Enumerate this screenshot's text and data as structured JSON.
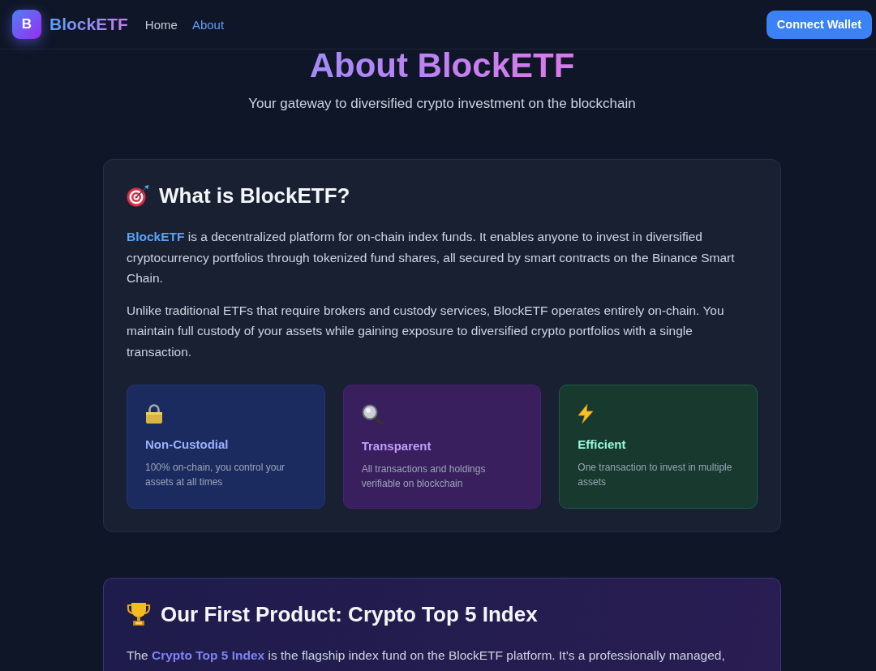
{
  "header": {
    "logo_letter": "B",
    "brand": "BlockETF",
    "nav": [
      {
        "label": "Home",
        "selected": false
      },
      {
        "label": "About",
        "selected": true
      }
    ],
    "button": "Connect Wallet"
  },
  "hero": {
    "title": "About BlockETF",
    "subtitle": "Your gateway to diversified crypto investment on the blockchain"
  },
  "sections": [
    {
      "kind": "standard",
      "heading": "What is BlockETF?",
      "paragraphs": [
        "**BlockETF** is a decentralized platform for on-chain index funds. It enables anyone to invest in diversified cryptocurrency portfolios through tokenized fund shares, all secured by smart contracts on the Binance Smart Chain.",
        "Unlike traditional ETFs that require brokers and custody services, BlockETF operates entirely on-chain. You maintain full custody of your assets while gaining exposure to diversified crypto portfolios with a single transaction."
      ],
      "features": [
        {
          "title": "Non-Custodial",
          "description": "100% on-chain, you control your assets at all times",
          "color": "#1c2b5f"
        },
        {
          "title": "Transparent",
          "description": "All transactions and holdings verifiable on blockchain",
          "color": "#391f5e"
        },
        {
          "title": "Efficient",
          "description": "One transaction to invest in multiple assets",
          "color": "#17392e"
        }
      ]
    },
    {
      "kind": "featured",
      "heading": "Our First Product: Crypto Top 5 Index",
      "paragraphs": [
        "The **Crypto Top 5 Index** is the flagship index fund on the BlockETF platform. It’s a professionally managed,"
      ]
    }
  ]
}
